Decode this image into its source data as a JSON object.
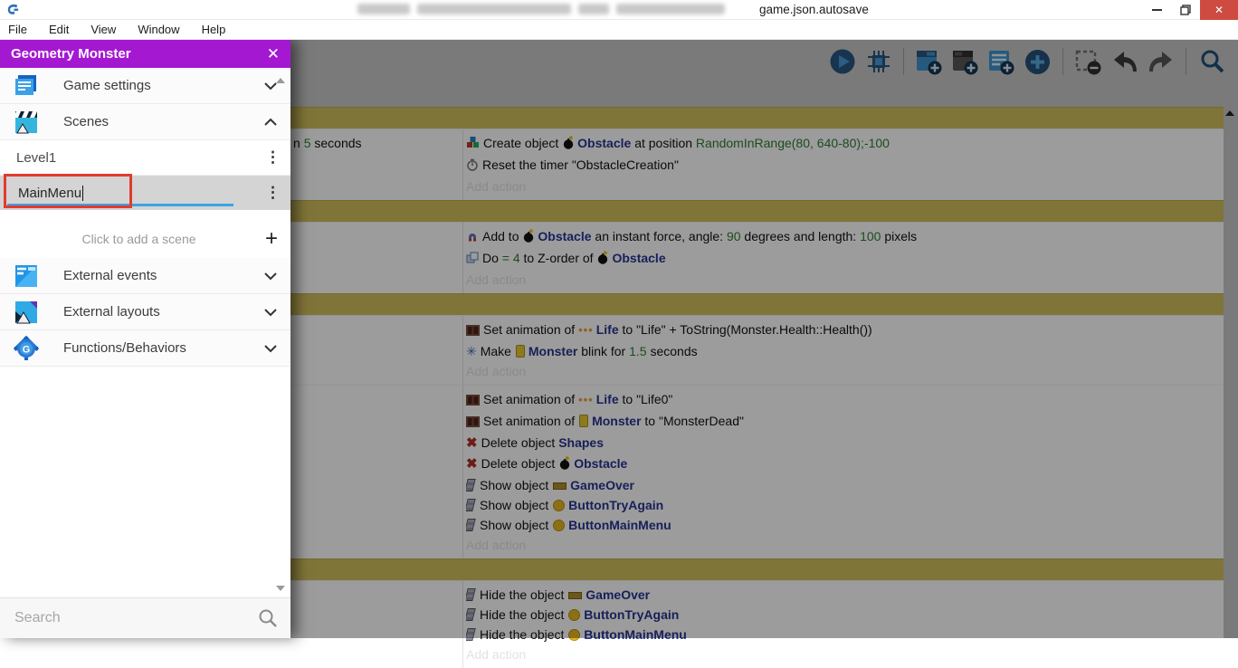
{
  "window": {
    "title_visible": "game.json.autosave",
    "controls": {
      "minimize": "minimize",
      "restore": "restore",
      "close": "close"
    }
  },
  "menubar": {
    "items": [
      "File",
      "Edit",
      "View",
      "Window",
      "Help"
    ]
  },
  "toolbar": {
    "icons": [
      "preview-play",
      "debugger",
      "add-event",
      "add-subevent",
      "add-comment",
      "add-something",
      "delete-event",
      "undo",
      "redo",
      "search"
    ]
  },
  "colors": {
    "drawer_header": "#a518d2",
    "group_bar_gold": "#d2bf5d",
    "object_link": "#283593",
    "parameter_green": "#2e7d32",
    "annotation_red": "#e23b2e",
    "edit_underline_blue": "#3ea3e3",
    "close_button_red": "#cd4b41"
  },
  "drawer": {
    "header": {
      "title": "Geometry Monster",
      "close_icon": "close-icon"
    },
    "sections": [
      {
        "label": "Game settings",
        "icon": "game-settings-icon",
        "chevron": "down"
      },
      {
        "label": "Scenes",
        "icon": "scenes-icon",
        "chevron": "up"
      }
    ],
    "scenes": {
      "items": [
        {
          "name": "Level1"
        }
      ],
      "editing": {
        "value": "MainMenu"
      },
      "add_label": "Click to add a scene"
    },
    "more_sections": [
      {
        "label": "External events",
        "icon": "external-events-icon",
        "chevron": "down"
      },
      {
        "label": "External layouts",
        "icon": "external-layouts-icon",
        "chevron": "down"
      },
      {
        "label": "Functions/Behaviors",
        "icon": "functions-behaviors-icon",
        "chevron": "down"
      }
    ],
    "search": {
      "placeholder": "Search",
      "icon": "search-icon"
    }
  },
  "events_sheet": {
    "add_action_label": "Add action",
    "events": [
      {
        "type": "group"
      },
      {
        "type": "event",
        "conditions": [
          {
            "segs": [
              {
                "t": "n "
              },
              {
                "t": "5",
                "c": "param"
              },
              {
                "t": " seconds"
              }
            ]
          }
        ],
        "actions": [
          {
            "icon": "create",
            "segs": [
              {
                "t": "Create object "
              },
              {
                "ic": "bomb"
              },
              {
                "t": "Obstacle",
                "c": "object"
              },
              {
                "t": " at position "
              },
              {
                "t": "RandomInRange(80, 640-80);-100",
                "c": "param"
              }
            ]
          },
          {
            "icon": "timer",
            "segs": [
              {
                "t": "Reset the timer \"ObstacleCreation\""
              }
            ]
          },
          {
            "type": "add"
          }
        ]
      },
      {
        "type": "group"
      },
      {
        "type": "event",
        "conditions": [],
        "actions": [
          {
            "icon": "force",
            "segs": [
              {
                "t": "Add to "
              },
              {
                "ic": "bomb"
              },
              {
                "t": "Obstacle",
                "c": "object"
              },
              {
                "t": " an instant force, angle: "
              },
              {
                "t": "90",
                "c": "param"
              },
              {
                "t": " degrees and length: "
              },
              {
                "t": "100",
                "c": "param"
              },
              {
                "t": " pixels"
              }
            ]
          },
          {
            "icon": "zorder",
            "segs": [
              {
                "t": "Do "
              },
              {
                "t": "= 4",
                "c": "param"
              },
              {
                "t": " to Z-order of "
              },
              {
                "ic": "bomb"
              },
              {
                "t": "Obstacle",
                "c": "object"
              }
            ]
          },
          {
            "type": "add"
          }
        ]
      },
      {
        "type": "group"
      },
      {
        "type": "event",
        "conditions": [],
        "actions": [
          {
            "icon": "animation",
            "segs": [
              {
                "t": "Set animation of "
              },
              {
                "ic": "life"
              },
              {
                "t": "Life",
                "c": "object"
              },
              {
                "t": " to "
              },
              {
                "t": "\"Life\" + ToString(Monster.Health::Health())"
              }
            ]
          },
          {
            "icon": "blink",
            "segs": [
              {
                "t": "Make "
              },
              {
                "ic": "monster"
              },
              {
                "t": "Monster",
                "c": "object"
              },
              {
                "t": " blink for "
              },
              {
                "t": "1.5",
                "c": "param"
              },
              {
                "t": " seconds"
              }
            ]
          },
          {
            "type": "add"
          }
        ]
      },
      {
        "type": "event",
        "conditions": [],
        "actions": [
          {
            "icon": "animation",
            "segs": [
              {
                "t": "Set animation of "
              },
              {
                "ic": "life"
              },
              {
                "t": "Life",
                "c": "object"
              },
              {
                "t": " to "
              },
              {
                "t": "\"Life0\""
              }
            ]
          },
          {
            "icon": "animation",
            "segs": [
              {
                "t": "Set animation of "
              },
              {
                "ic": "monster"
              },
              {
                "t": "Monster",
                "c": "object"
              },
              {
                "t": " to "
              },
              {
                "t": "\"MonsterDead\""
              }
            ]
          },
          {
            "icon": "delete",
            "segs": [
              {
                "t": "Delete object "
              },
              {
                "t": "Shapes",
                "c": "object"
              }
            ]
          },
          {
            "icon": "delete",
            "segs": [
              {
                "t": "Delete object "
              },
              {
                "ic": "bomb"
              },
              {
                "t": "Obstacle",
                "c": "object"
              }
            ]
          },
          {
            "icon": "visibility",
            "segs": [
              {
                "t": "Show object "
              },
              {
                "ic": "banner"
              },
              {
                "t": "GameOver",
                "c": "object"
              }
            ]
          },
          {
            "icon": "visibility",
            "segs": [
              {
                "t": "Show object "
              },
              {
                "ic": "ybutton"
              },
              {
                "t": "ButtonTryAgain",
                "c": "object"
              }
            ]
          },
          {
            "icon": "visibility",
            "segs": [
              {
                "t": "Show object "
              },
              {
                "ic": "ybutton"
              },
              {
                "t": "ButtonMainMenu",
                "c": "object"
              }
            ]
          },
          {
            "type": "add"
          }
        ]
      },
      {
        "type": "group"
      },
      {
        "type": "event",
        "conditions": [],
        "actions": [
          {
            "icon": "visibility",
            "segs": [
              {
                "t": "Hide the object "
              },
              {
                "ic": "banner"
              },
              {
                "t": "GameOver",
                "c": "object"
              }
            ]
          },
          {
            "icon": "visibility",
            "segs": [
              {
                "t": "Hide the object "
              },
              {
                "ic": "ybutton"
              },
              {
                "t": "ButtonTryAgain",
                "c": "object"
              }
            ]
          },
          {
            "icon": "visibility",
            "segs": [
              {
                "t": "Hide the object "
              },
              {
                "ic": "ybutton"
              },
              {
                "t": "ButtonMainMenu",
                "c": "object"
              }
            ]
          },
          {
            "type": "add"
          }
        ]
      }
    ]
  }
}
